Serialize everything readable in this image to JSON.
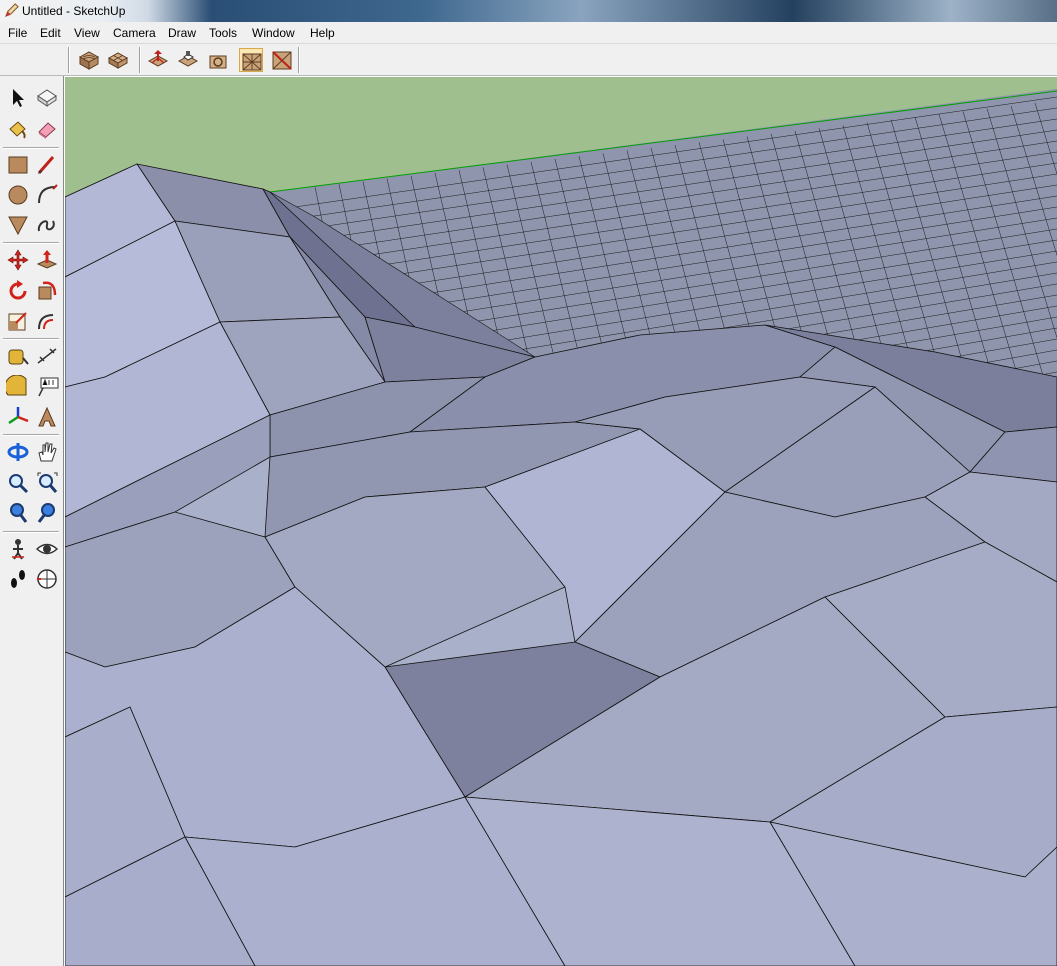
{
  "window": {
    "title": "Untitled - SketchUp",
    "icon": "sketchup-pencil-icon"
  },
  "menu": [
    {
      "label": "File"
    },
    {
      "label": "Edit"
    },
    {
      "label": "View"
    },
    {
      "label": "Camera"
    },
    {
      "label": "Draw"
    },
    {
      "label": "Tools"
    },
    {
      "label": "Window"
    },
    {
      "label": "Help"
    }
  ],
  "sandbox_toolbar": [
    {
      "icon": "sandbox-from-contours-icon"
    },
    {
      "icon": "sandbox-from-scratch-icon"
    },
    {
      "icon": "smoove-icon"
    },
    {
      "icon": "stamp-icon"
    },
    {
      "icon": "drape-icon"
    },
    {
      "icon": "add-detail-icon"
    },
    {
      "icon": "flip-edge-icon"
    }
  ],
  "large_tool_set": [
    {
      "icon": "select-icon"
    },
    {
      "icon": "make-component-icon"
    },
    {
      "icon": "paint-bucket-icon"
    },
    {
      "icon": "eraser-icon"
    },
    {
      "icon": "rectangle-icon"
    },
    {
      "icon": "line-icon"
    },
    {
      "icon": "circle-icon"
    },
    {
      "icon": "arc-icon"
    },
    {
      "icon": "polygon-icon"
    },
    {
      "icon": "freehand-icon"
    },
    {
      "icon": "move-icon"
    },
    {
      "icon": "push-pull-icon"
    },
    {
      "icon": "rotate-icon"
    },
    {
      "icon": "follow-me-icon"
    },
    {
      "icon": "scale-icon"
    },
    {
      "icon": "offset-icon"
    },
    {
      "icon": "tape-measure-icon"
    },
    {
      "icon": "dimension-icon"
    },
    {
      "icon": "protractor-icon"
    },
    {
      "icon": "text-icon"
    },
    {
      "icon": "axes-icon"
    },
    {
      "icon": "3d-text-icon"
    },
    {
      "icon": "orbit-icon"
    },
    {
      "icon": "pan-icon"
    },
    {
      "icon": "zoom-icon"
    },
    {
      "icon": "zoom-window-icon"
    },
    {
      "icon": "previous-view-icon"
    },
    {
      "icon": "next-view-icon"
    },
    {
      "icon": "position-camera-icon"
    },
    {
      "icon": "look-around-icon"
    },
    {
      "icon": "walk-icon"
    },
    {
      "icon": "section-plane-icon"
    }
  ],
  "scene": {
    "sky_color": "#9fbf8e",
    "surface_color": "#a8aec8",
    "edge_color": "#1a1a1a",
    "horizon_axis_color": "#00a000"
  }
}
